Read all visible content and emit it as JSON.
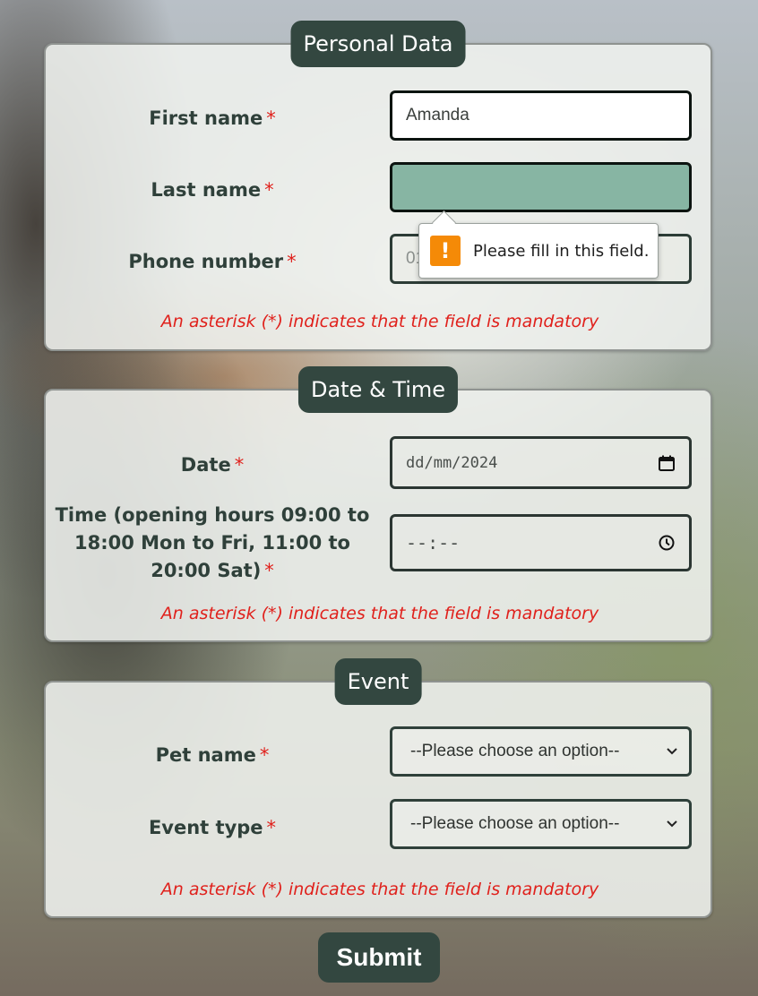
{
  "personal": {
    "legend": "Personal Data",
    "first_name": {
      "label": "First name",
      "star": "*",
      "value": "Amanda"
    },
    "last_name": {
      "label": "Last name",
      "star": "*",
      "value": ""
    },
    "phone": {
      "label": "Phone number",
      "star": "*",
      "value_visible": "01"
    },
    "note": "An asterisk (*) indicates that the field is mandatory"
  },
  "tooltip": {
    "icon": "!",
    "text": "Please fill in this field."
  },
  "datetime": {
    "legend": "Date & Time",
    "date": {
      "label": "Date",
      "star": "*",
      "value": "dd/mm/2024"
    },
    "time": {
      "label_line1": "Time (opening hours 09:00 to",
      "label_line2": "18:00 Mon to Fri, 11:00 to",
      "label_line3": "20:00 Sat)",
      "star": "*",
      "value": "--:--"
    },
    "note": "An asterisk (*) indicates that the field is mandatory"
  },
  "event": {
    "legend": "Event",
    "pet_name": {
      "label": "Pet name",
      "star": "*",
      "selected": "--Please choose an option--"
    },
    "event_type": {
      "label": "Event type",
      "star": "*",
      "selected": "--Please choose an option--"
    },
    "note": "An asterisk (*) indicates that the field is mandatory"
  },
  "submit_label": "Submit",
  "colors": {
    "legend_bg": "#334740",
    "invalid_input_bg": "#87b5a3",
    "required_red": "#e0211c",
    "warning_orange": "#f58a07"
  }
}
